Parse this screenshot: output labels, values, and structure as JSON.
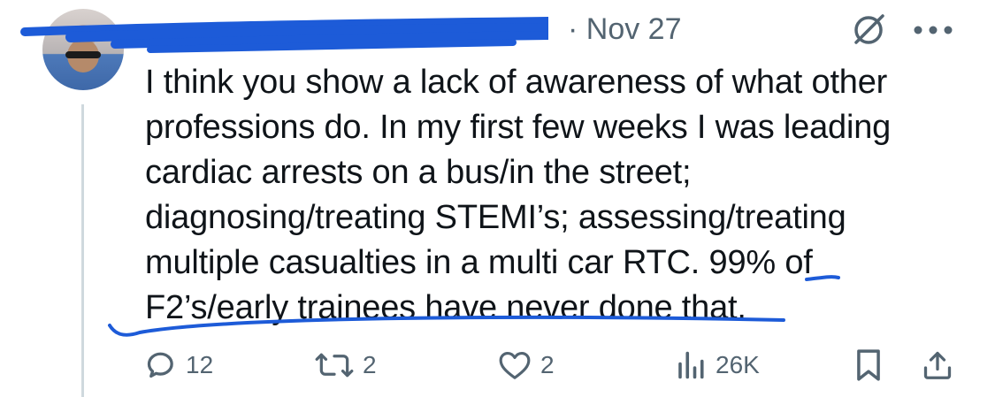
{
  "tweet": {
    "date": "· Nov 27",
    "text": "I think you show a lack of awareness of what other\nprofessions do. In my first few weeks I was leading\ncardiac arrests on a bus/in the street;\ndiagnosing/treating STEMI’s; assessing/treating\nmultiple casualties in a multi car RTC. 99% of\nF2’s/early trainees have never done that."
  },
  "actions": {
    "replies": "12",
    "reposts": "2",
    "likes": "2",
    "views": "26K"
  },
  "icons": {
    "reply": "reply-icon",
    "repost": "repost-icon",
    "like": "heart-icon",
    "views": "views-icon",
    "bookmark": "bookmark-icon",
    "share": "share-icon",
    "grok": "grok-icon",
    "more": "more-icon"
  },
  "colors": {
    "text": "#0f1419",
    "muted": "#536471",
    "pen": "#1d5bd8"
  }
}
